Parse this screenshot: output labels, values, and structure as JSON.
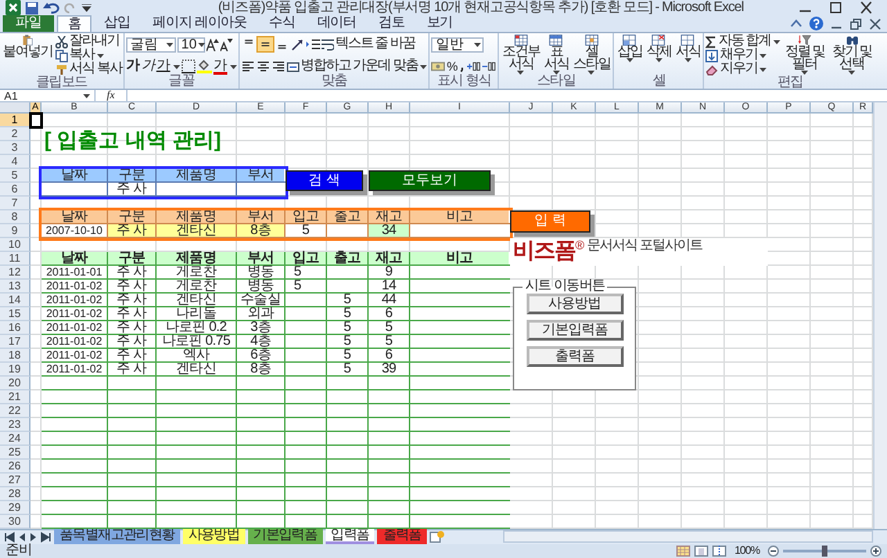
{
  "window": {
    "title": "(비즈폼)약품 입출고 관리대장(부서명 10개 현재고공식항목 추가)  [호환 모드] - Microsoft Excel"
  },
  "ribbon_tabs": [
    {
      "label": "파일",
      "kind": "file",
      "selected": false
    },
    {
      "label": "홈",
      "kind": "tab",
      "selected": true
    },
    {
      "label": "삽입",
      "kind": "tab",
      "selected": false
    },
    {
      "label": "페이지 레이아웃",
      "kind": "tab",
      "selected": false
    },
    {
      "label": "수식",
      "kind": "tab",
      "selected": false
    },
    {
      "label": "데이터",
      "kind": "tab",
      "selected": false
    },
    {
      "label": "검토",
      "kind": "tab",
      "selected": false
    },
    {
      "label": "보기",
      "kind": "tab",
      "selected": false
    }
  ],
  "clipboard": {
    "label": "클립보드",
    "paste": "붙여넣기",
    "cut": "잘라내기",
    "copy": "복사",
    "format_painter": "서식 복사"
  },
  "font": {
    "label": "글꼴",
    "name": "굴림",
    "size": "10",
    "styles": [
      "가",
      "가",
      "가"
    ],
    "color_glyph": "가"
  },
  "alignment": {
    "label": "맞춤",
    "vertical": [
      {
        "selected": false
      },
      {
        "selected": true
      },
      {
        "selected": false
      }
    ],
    "wrap": "텍스트 줄 바꿈",
    "merge": "병합하고 가운데 맞춤"
  },
  "number": {
    "label": "표시 형식",
    "format": "일반",
    "percent": "%"
  },
  "styles": {
    "label": "스타일",
    "items": [
      "조건부 서식",
      "표 서식",
      "셀 스타일"
    ]
  },
  "cells": {
    "label": "셀",
    "items": [
      "삽입",
      "삭제",
      "서식"
    ]
  },
  "editing": {
    "label": "편집",
    "autosum": "자동 합계",
    "fill": "채우기",
    "clear": "지우기",
    "sort": "정렬 및 필터",
    "find": "찾기 및 선택"
  },
  "formula_bar": {
    "name_box": "A1",
    "fx": "fx"
  },
  "columns": [
    {
      "label": "A",
      "selected": true
    },
    {
      "label": "B",
      "selected": false
    },
    {
      "label": "C",
      "selected": false
    },
    {
      "label": "D",
      "selected": false
    },
    {
      "label": "E",
      "selected": false
    },
    {
      "label": "F",
      "selected": false
    },
    {
      "label": "G",
      "selected": false
    },
    {
      "label": "H",
      "selected": false
    },
    {
      "label": "I",
      "selected": false
    },
    {
      "label": "J",
      "selected": false
    },
    {
      "label": "K",
      "selected": false
    },
    {
      "label": "L",
      "selected": false
    },
    {
      "label": "M",
      "selected": false
    },
    {
      "label": "N",
      "selected": false
    },
    {
      "label": "O",
      "selected": false
    },
    {
      "label": "P",
      "selected": false
    },
    {
      "label": "Q",
      "selected": false
    },
    {
      "label": "R",
      "selected": false
    }
  ],
  "rows": [
    {
      "label": "1",
      "selected": true
    },
    {
      "label": "2",
      "selected": false
    },
    {
      "label": "3",
      "selected": false
    },
    {
      "label": "4",
      "selected": false
    },
    {
      "label": "5",
      "selected": false
    },
    {
      "label": "6",
      "selected": false
    },
    {
      "label": "7",
      "selected": false
    },
    {
      "label": "8",
      "selected": false
    },
    {
      "label": "9",
      "selected": false
    },
    {
      "label": "10",
      "selected": false
    },
    {
      "label": "11",
      "selected": false
    },
    {
      "label": "12",
      "selected": false
    },
    {
      "label": "13",
      "selected": false
    },
    {
      "label": "14",
      "selected": false
    },
    {
      "label": "15",
      "selected": false
    },
    {
      "label": "16",
      "selected": false
    },
    {
      "label": "17",
      "selected": false
    },
    {
      "label": "18",
      "selected": false
    },
    {
      "label": "19",
      "selected": false
    },
    {
      "label": "20",
      "selected": false
    },
    {
      "label": "21",
      "selected": false
    },
    {
      "label": "22",
      "selected": false
    },
    {
      "label": "23",
      "selected": false
    },
    {
      "label": "24",
      "selected": false
    },
    {
      "label": "25",
      "selected": false
    },
    {
      "label": "26",
      "selected": false
    },
    {
      "label": "27",
      "selected": false
    },
    {
      "label": "28",
      "selected": false
    },
    {
      "label": "29",
      "selected": false
    },
    {
      "label": "30",
      "selected": false
    }
  ],
  "title": "[ 입출고 내역 관리]",
  "search": {
    "fields": [
      {
        "header": "날짜"
      },
      {
        "header": "구분",
        "value": "주 사"
      },
      {
        "header": "제품명"
      },
      {
        "header": "부서"
      }
    ]
  },
  "search_button": "검 색",
  "show_all_button": "모두보기",
  "entry": {
    "fields": [
      {
        "header": "날짜",
        "value": "2007-10-10",
        "color": "#ffffff"
      },
      {
        "header": "구분",
        "value": "주 사",
        "color": "#ffff99"
      },
      {
        "header": "제품명",
        "value": "겐타신",
        "color": "#ffff99"
      },
      {
        "header": "부서",
        "value": "8층",
        "color": "#ffff99"
      },
      {
        "header": "입고",
        "value": "5",
        "color": "#ffffff"
      },
      {
        "header": "출고"
      },
      {
        "header": "재고",
        "value": "34",
        "color": "#ccffcc"
      },
      {
        "header": "비고"
      }
    ]
  },
  "entry_button": "입 력",
  "list": {
    "headers": [
      "날짜",
      "구분",
      "제품명",
      "부서",
      "입고",
      "출고",
      "재고",
      "비고"
    ],
    "rows": [
      {
        "date": "2011-01-01",
        "type": "주 사",
        "product": "게로찬",
        "dept": "병동",
        "in": "5",
        "stock": "9"
      },
      {
        "date": "2011-01-02",
        "type": "주 사",
        "product": "게로찬",
        "dept": "병동",
        "in": "5",
        "stock": "14"
      },
      {
        "date": "2011-01-02",
        "type": "주 사",
        "product": "겐타신",
        "dept": "수술실",
        "out": "5",
        "stock": "44"
      },
      {
        "date": "2011-01-02",
        "type": "주 사",
        "product": "나리돌",
        "dept": "외과",
        "out": "5",
        "stock": "6"
      },
      {
        "date": "2011-01-02",
        "type": "주 사",
        "product": "나로핀 0.2",
        "dept": "3층",
        "out": "5",
        "stock": "5"
      },
      {
        "date": "2011-01-02",
        "type": "주 사",
        "product": "나로핀 0.75",
        "dept": "4층",
        "out": "5",
        "stock": "5"
      },
      {
        "date": "2011-01-02",
        "type": "주 사",
        "product": "엑사",
        "dept": "6층",
        "out": "5",
        "stock": "6"
      },
      {
        "date": "2011-01-02",
        "type": "주 사",
        "product": "겐타신",
        "dept": "8층",
        "out": "5",
        "stock": "39"
      }
    ]
  },
  "logo": {
    "name": "비즈폼",
    "mark": "®",
    "tagline": "문서서식 포털사이트"
  },
  "sheet_nav": {
    "title": "시트 이동버튼",
    "buttons": [
      "사용방법",
      "기본입력폼",
      "출력폼"
    ]
  },
  "sheet_tabs": [
    {
      "label": "품목별재고관리현황",
      "selected": false,
      "color": "#7fa7e0"
    },
    {
      "label": "사용방법",
      "selected": false,
      "color": "#ffff66"
    },
    {
      "label": "기본입력폼",
      "selected": false,
      "color": "#66b04c"
    },
    {
      "label": "입력폼",
      "selected": true,
      "color": "#9f8fe0"
    },
    {
      "label": "출력폼",
      "selected": false,
      "color": "#ee2a2a"
    }
  ],
  "status_bar": {
    "text": "준비",
    "zoom": "100%",
    "zoom_slider": {
      "level": 0.5
    }
  }
}
